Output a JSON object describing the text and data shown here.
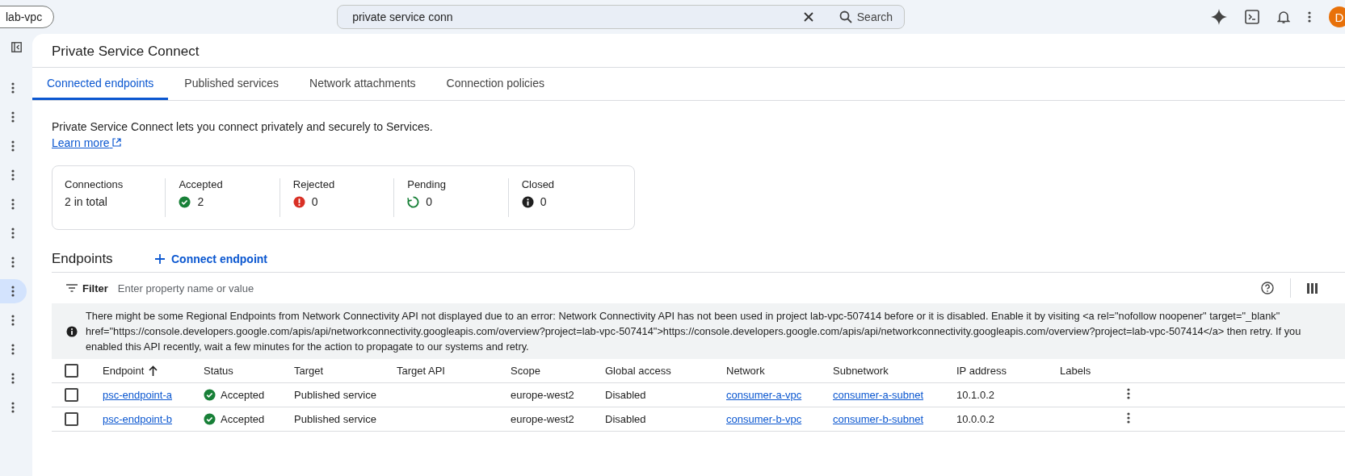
{
  "topbar": {
    "project": "lab-vpc",
    "search": {
      "value": "private service conn",
      "button": "Search"
    },
    "avatar": "D"
  },
  "rail_items": [
    {
      "selected": false
    },
    {
      "selected": false
    },
    {
      "selected": false
    },
    {
      "selected": false
    },
    {
      "selected": false
    },
    {
      "selected": false
    },
    {
      "selected": false
    },
    {
      "selected": true
    },
    {
      "selected": false
    },
    {
      "selected": false
    },
    {
      "selected": false
    },
    {
      "selected": false
    }
  ],
  "page": {
    "title": "Private Service Connect"
  },
  "tabs": [
    {
      "label": "Connected endpoints",
      "selected": true
    },
    {
      "label": "Published services",
      "selected": false
    },
    {
      "label": "Network attachments",
      "selected": false
    },
    {
      "label": "Connection policies",
      "selected": false
    }
  ],
  "description": {
    "text": "Private Service Connect lets you connect privately and securely to Services.",
    "link": "Learn more"
  },
  "summary": [
    {
      "label": "Connections",
      "value": "2 in total",
      "kind": "total"
    },
    {
      "label": "Accepted",
      "value": "2",
      "kind": "accepted"
    },
    {
      "label": "Rejected",
      "value": "0",
      "kind": "rejected"
    },
    {
      "label": "Pending",
      "value": "0",
      "kind": "pending"
    },
    {
      "label": "Closed",
      "value": "0",
      "kind": "closed"
    }
  ],
  "endpoints": {
    "title": "Endpoints",
    "action": "Connect endpoint",
    "filter": {
      "label": "Filter",
      "placeholder": "Enter property name or value"
    },
    "warning": "There might be some Regional Endpoints from Network Connectivity API not displayed due to an error: Network Connectivity API has not been used in project lab-vpc-507414 before or it is disabled. Enable it by visiting <a rel=\"nofollow noopener\" target=\"_blank\" href=\"https://console.developers.google.com/apis/api/networkconnectivity.googleapis.com/overview?project=lab-vpc-507414\">https://console.developers.google.com/apis/api/networkconnectivity.googleapis.com/overview?project=lab-vpc-507414</a> then retry. If you enabled this API recently, wait a few minutes for the action to propagate to our systems and retry.",
    "header_checked": false,
    "columns": [
      {
        "label": "Endpoint",
        "sorted": true
      },
      {
        "label": "Status",
        "sorted": false
      },
      {
        "label": "Target",
        "sorted": false
      },
      {
        "label": "Target API",
        "sorted": false
      },
      {
        "label": "Scope",
        "sorted": false
      },
      {
        "label": "Global access",
        "sorted": false
      },
      {
        "label": "Network",
        "sorted": false
      },
      {
        "label": "Subnetwork",
        "sorted": false
      },
      {
        "label": "IP address",
        "sorted": false
      },
      {
        "label": "Labels",
        "sorted": false
      }
    ],
    "rows": [
      {
        "checked": false,
        "endpoint": "psc-endpoint-a",
        "status": "Accepted",
        "kind": "accepted",
        "target": "Published service",
        "scope": "europe-west2",
        "global_access": "Disabled",
        "network": "consumer-a-vpc",
        "subnetwork": "consumer-a-subnet",
        "ip": "10.1.0.2"
      },
      {
        "checked": false,
        "endpoint": "psc-endpoint-b",
        "status": "Accepted",
        "kind": "accepted",
        "target": "Published service",
        "scope": "europe-west2",
        "global_access": "Disabled",
        "network": "consumer-b-vpc",
        "subnetwork": "consumer-b-subnet",
        "ip": "10.0.0.2"
      }
    ]
  }
}
